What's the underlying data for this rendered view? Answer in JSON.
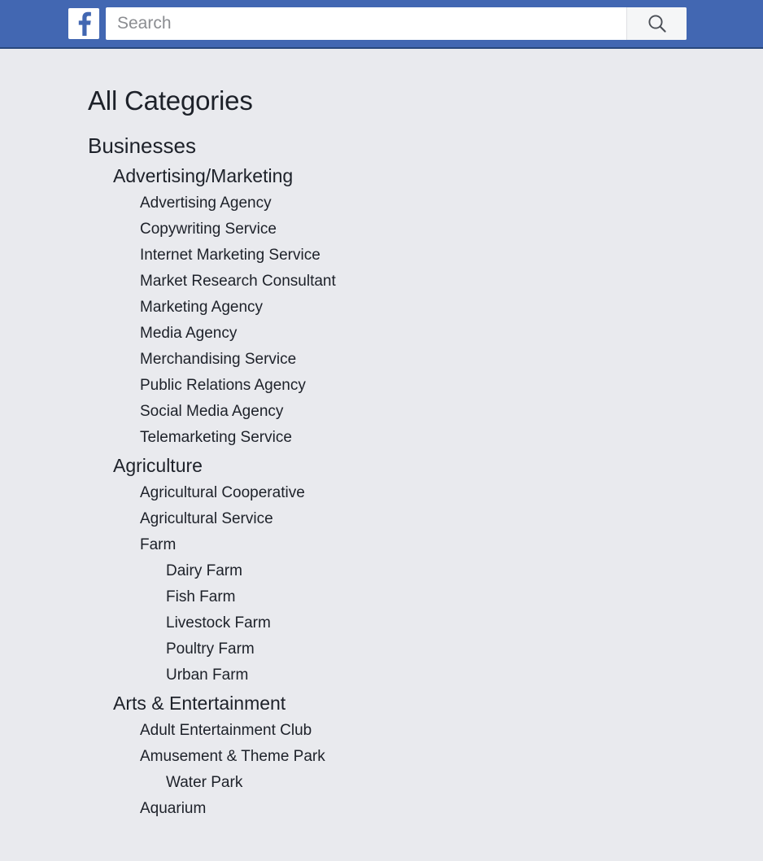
{
  "header": {
    "logo_icon": "facebook-logo-icon",
    "search": {
      "placeholder": "Search",
      "value": "",
      "button_icon": "search-icon"
    },
    "brand_color": "#4267b2",
    "border_color": "#29487d"
  },
  "page": {
    "title": "All Categories",
    "background_color": "#e9eaee",
    "text_color": "#1d2129"
  },
  "tree": [
    {
      "label": "Businesses",
      "level": 1,
      "children": [
        {
          "label": "Advertising/Marketing",
          "level": 2,
          "children": [
            {
              "label": "Advertising Agency",
              "level": 3,
              "children": []
            },
            {
              "label": "Copywriting Service",
              "level": 3,
              "children": []
            },
            {
              "label": "Internet Marketing Service",
              "level": 3,
              "children": []
            },
            {
              "label": "Market Research Consultant",
              "level": 3,
              "children": []
            },
            {
              "label": "Marketing Agency",
              "level": 3,
              "children": []
            },
            {
              "label": "Media Agency",
              "level": 3,
              "children": []
            },
            {
              "label": "Merchandising Service",
              "level": 3,
              "children": []
            },
            {
              "label": "Public Relations Agency",
              "level": 3,
              "children": []
            },
            {
              "label": "Social Media Agency",
              "level": 3,
              "children": []
            },
            {
              "label": "Telemarketing Service",
              "level": 3,
              "children": []
            }
          ]
        },
        {
          "label": "Agriculture",
          "level": 2,
          "children": [
            {
              "label": "Agricultural Cooperative",
              "level": 3,
              "children": []
            },
            {
              "label": "Agricultural Service",
              "level": 3,
              "children": []
            },
            {
              "label": "Farm",
              "level": 3,
              "children": [
                {
                  "label": "Dairy Farm",
                  "level": 4,
                  "children": []
                },
                {
                  "label": "Fish Farm",
                  "level": 4,
                  "children": []
                },
                {
                  "label": "Livestock Farm",
                  "level": 4,
                  "children": []
                },
                {
                  "label": "Poultry Farm",
                  "level": 4,
                  "children": []
                },
                {
                  "label": "Urban Farm",
                  "level": 4,
                  "children": []
                }
              ]
            }
          ]
        },
        {
          "label": "Arts & Entertainment",
          "level": 2,
          "children": [
            {
              "label": "Adult Entertainment Club",
              "level": 3,
              "children": []
            },
            {
              "label": "Amusement & Theme Park",
              "level": 3,
              "children": [
                {
                  "label": "Water Park",
                  "level": 4,
                  "children": []
                }
              ]
            },
            {
              "label": "Aquarium",
              "level": 3,
              "children": []
            }
          ]
        }
      ]
    }
  ]
}
